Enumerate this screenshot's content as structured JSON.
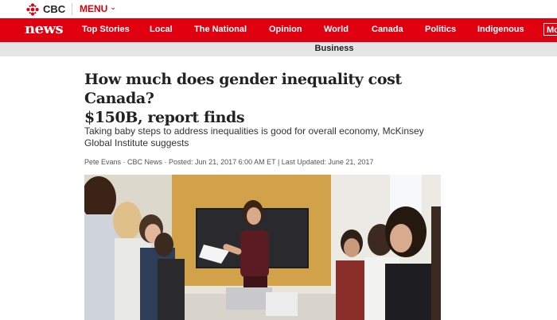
{
  "header": {
    "brand": "CBC",
    "menu_label": "MENU",
    "brand_color": "#e1000f"
  },
  "nav": {
    "logo": "news",
    "items": [
      "Top Stories",
      "Local",
      "The National",
      "Opinion",
      "World",
      "Canada",
      "Politics",
      "Indigenous"
    ],
    "more_label": "Mo"
  },
  "section": {
    "label": "Business"
  },
  "article": {
    "headline_line1": "How much does gender inequality cost Canada?",
    "headline_line2": "$150B, report finds",
    "summary_line1": "Taking baby steps to address inequalities is good for overall economy, McKinsey",
    "summary_line2": "Global Institute suggests",
    "byline": "Pete Evans · CBC News · Posted: Jun 21, 2017 6:00 AM ET | Last Updated: June 21, 2017"
  },
  "icons": {
    "logo": "cbc-gem-icon",
    "menu": "chevron-down-icon"
  }
}
